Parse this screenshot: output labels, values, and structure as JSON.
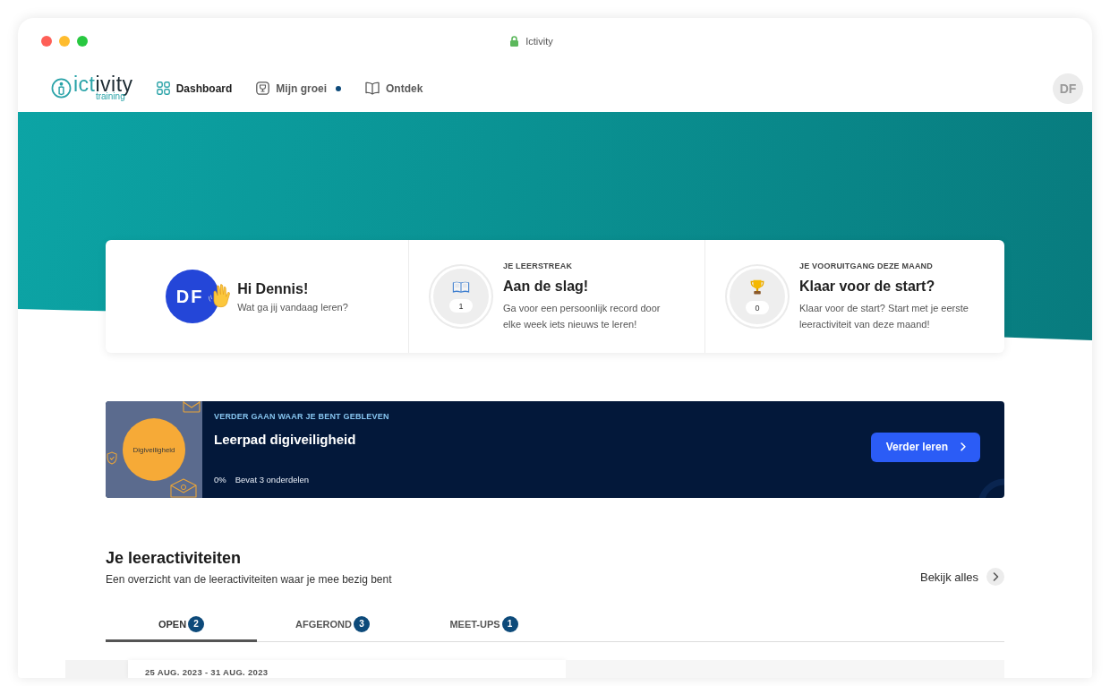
{
  "window": {
    "title": "Ictivity"
  },
  "nav": {
    "logo": {
      "wordmark": [
        "ict",
        "ivity"
      ],
      "tagline": "training"
    },
    "items": [
      {
        "label": "Dashboard",
        "selected": true,
        "notification": false
      },
      {
        "label": "Mijn groei",
        "selected": false,
        "notification": true
      },
      {
        "label": "Ontdek",
        "selected": false,
        "notification": false
      }
    ],
    "avatar": "DF"
  },
  "welcome": {
    "greeting": {
      "initials": "DF",
      "title": "Hi Dennis!",
      "subtitle": "Wat ga jij vandaag leren?"
    },
    "stats": [
      {
        "kind": "streak",
        "label": "JE LEERSTREAK",
        "count": "1",
        "title": "Aan de slag!",
        "description": "Ga voor een persoonlijk record door elke week iets nieuws te leren!"
      },
      {
        "kind": "progress",
        "label": "JE VOORUITGANG DEZE MAAND",
        "count": "0",
        "title": "Klaar voor de start?",
        "description": "Klaar voor de start? Start met je eerste leeractiviteit van deze maand!"
      }
    ]
  },
  "continue": {
    "image_label": "Digiveiligheid",
    "eyebrow": "VERDER GAAN WAAR JE BENT GEBLEVEN",
    "title": "Leerpad digiveiligheid",
    "progress": "0%",
    "parts": "Bevat 3 onderdelen",
    "button": "Verder leren"
  },
  "activities": {
    "title": "Je leeractiviteiten",
    "subtitle": "Een overzicht van de leeractiviteiten waar je mee bezig bent",
    "link": "Bekijk alles",
    "tabs": [
      {
        "label": "OPEN",
        "count": "2",
        "selected": true
      },
      {
        "label": "AFGEROND",
        "count": "3",
        "selected": false
      },
      {
        "label": "MEET-UPS",
        "count": "1",
        "selected": false
      }
    ],
    "cards": [
      {
        "date": "25 AUG. 2023 - 31 AUG. 2023"
      }
    ]
  }
}
